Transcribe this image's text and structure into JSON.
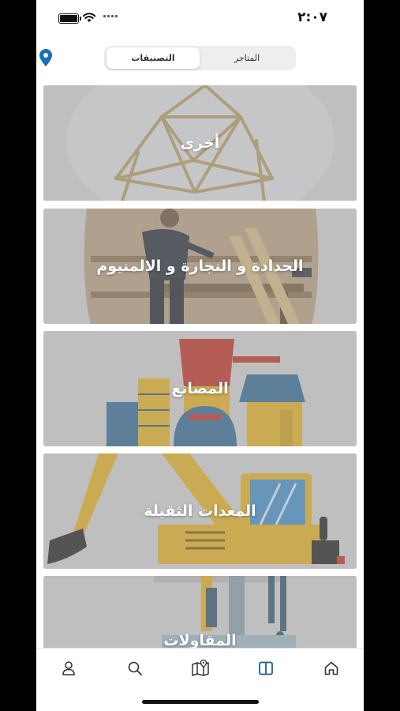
{
  "status_bar": {
    "time": "٢:٠٧"
  },
  "header": {
    "location_icon": "map-pin-icon",
    "segments": [
      {
        "label": "التصنيفات",
        "active": true
      },
      {
        "label": "المتاجر",
        "active": false
      }
    ]
  },
  "categories": [
    {
      "label": "أخرى",
      "art": "wire-frame-structure"
    },
    {
      "label": "الحدادة و النجارة و الالمنيوم",
      "art": "carpenter-workshop"
    },
    {
      "label": "المصانع",
      "art": "factory"
    },
    {
      "label": "المعدات الثقيلة",
      "art": "excavator"
    },
    {
      "label": "المقاولات",
      "art": "construction-site"
    }
  ],
  "tab_bar": {
    "items": [
      {
        "name": "profile",
        "icon": "user-icon"
      },
      {
        "name": "search",
        "icon": "search-icon"
      },
      {
        "name": "map",
        "icon": "map-icon"
      },
      {
        "name": "categories",
        "icon": "book-icon",
        "active": true
      },
      {
        "name": "home",
        "icon": "home-icon"
      }
    ],
    "accent": "#1d5f9a"
  },
  "colors": {
    "accent": "#1d5f9a",
    "pin": "#1a6fb5"
  }
}
